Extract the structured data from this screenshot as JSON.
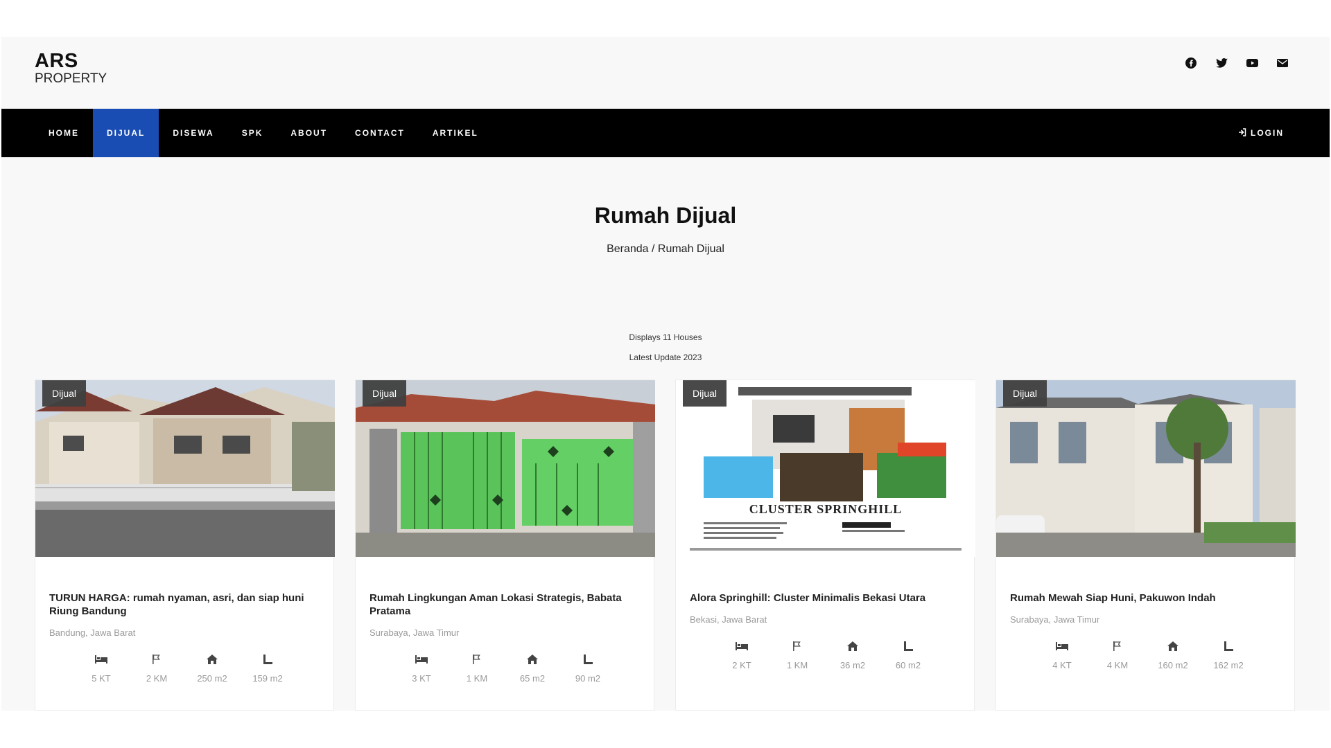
{
  "brand": {
    "main": "ARS",
    "sub": "PROPERTY"
  },
  "social": [
    "facebook-icon",
    "twitter-icon",
    "youtube-icon",
    "mail-icon"
  ],
  "nav": {
    "items": [
      "HOME",
      "DIJUAL",
      "DISEWA",
      "SPK",
      "ABOUT",
      "CONTACT",
      "ARTIKEL"
    ],
    "active": "DIJUAL",
    "login": "LOGIN"
  },
  "hero": {
    "title": "Rumah Dijual",
    "breadcrumb": "Beranda / Rumah Dijual"
  },
  "listing_info": {
    "count_text": "Displays 11 Houses",
    "update_text": "Latest Update 2023"
  },
  "colors": {
    "navbar": "#000000",
    "active_nav": "#1a4db3",
    "badge": "#404040"
  },
  "cards": [
    {
      "badge": "Dijual",
      "title": "TURUN HARGA: rumah nyaman, asri, dan siap huni Riung Bandung",
      "location": "Bandung, Jawa Barat",
      "stats": [
        {
          "icon": "bed-icon",
          "label": "5 KT"
        },
        {
          "icon": "flag-icon",
          "label": "2 KM"
        },
        {
          "icon": "house-icon",
          "label": "250 m2"
        },
        {
          "icon": "land-icon",
          "label": "159 m2"
        }
      ]
    },
    {
      "badge": "Dijual",
      "title": "Rumah Lingkungan Aman Lokasi Strategis, Babata Pratama",
      "location": "Surabaya, Jawa Timur",
      "stats": [
        {
          "icon": "bed-icon",
          "label": "3 KT"
        },
        {
          "icon": "flag-icon",
          "label": "1 KM"
        },
        {
          "icon": "house-icon",
          "label": "65 m2"
        },
        {
          "icon": "land-icon",
          "label": "90 m2"
        }
      ]
    },
    {
      "badge": "Dijual",
      "title": "Alora Springhill: Cluster Minimalis Bekasi Utara",
      "location": "Bekasi, Jawa Barat",
      "image_text": "CLUSTER SPRINGHILL",
      "stats": [
        {
          "icon": "bed-icon",
          "label": "2 KT"
        },
        {
          "icon": "flag-icon",
          "label": "1 KM"
        },
        {
          "icon": "house-icon",
          "label": "36 m2"
        },
        {
          "icon": "land-icon",
          "label": "60 m2"
        }
      ]
    },
    {
      "badge": "Dijual",
      "title": "Rumah Mewah Siap Huni, Pakuwon Indah",
      "location": "Surabaya, Jawa Timur",
      "stats": [
        {
          "icon": "bed-icon",
          "label": "4 KT"
        },
        {
          "icon": "flag-icon",
          "label": "4 KM"
        },
        {
          "icon": "house-icon",
          "label": "160 m2"
        },
        {
          "icon": "land-icon",
          "label": "162 m2"
        }
      ]
    }
  ]
}
